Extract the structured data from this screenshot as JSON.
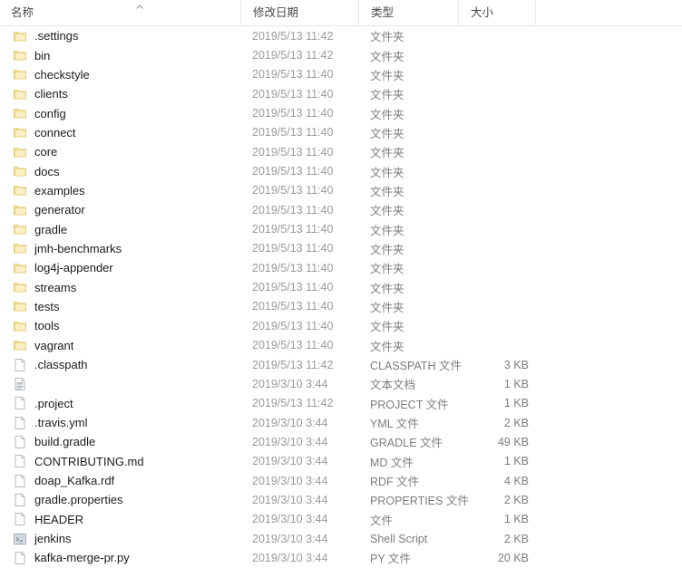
{
  "header": {
    "columns": [
      {
        "label": "名称",
        "key": "name"
      },
      {
        "label": "修改日期",
        "key": "date"
      },
      {
        "label": "类型",
        "key": "type"
      },
      {
        "label": "大小",
        "key": "size"
      }
    ],
    "sort_column": "名称",
    "sort_direction": "ascending",
    "sort_icon": "chevron-up-icon"
  },
  "colors": {
    "folder_fill": "#fbf0c4",
    "folder_edge": "#e8cf7e",
    "folder_tab": "#f5dd93",
    "file_fill": "#ffffff",
    "file_edge": "#b9b9b9",
    "text_primary": "#1b1b1b",
    "text_secondary": "#9a9a9a",
    "divider": "#eaeaea"
  },
  "rows": [
    {
      "name": ".settings",
      "icon": "folder-icon",
      "date": "2019/5/13 11:42",
      "type": "文件夹",
      "size": ""
    },
    {
      "name": "bin",
      "icon": "folder-icon",
      "date": "2019/5/13 11:42",
      "type": "文件夹",
      "size": ""
    },
    {
      "name": "checkstyle",
      "icon": "folder-icon",
      "date": "2019/5/13 11:40",
      "type": "文件夹",
      "size": ""
    },
    {
      "name": "clients",
      "icon": "folder-icon",
      "date": "2019/5/13 11:40",
      "type": "文件夹",
      "size": ""
    },
    {
      "name": "config",
      "icon": "folder-icon",
      "date": "2019/5/13 11:40",
      "type": "文件夹",
      "size": ""
    },
    {
      "name": "connect",
      "icon": "folder-icon",
      "date": "2019/5/13 11:40",
      "type": "文件夹",
      "size": ""
    },
    {
      "name": "core",
      "icon": "folder-icon",
      "date": "2019/5/13 11:40",
      "type": "文件夹",
      "size": ""
    },
    {
      "name": "docs",
      "icon": "folder-icon",
      "date": "2019/5/13 11:40",
      "type": "文件夹",
      "size": ""
    },
    {
      "name": "examples",
      "icon": "folder-icon",
      "date": "2019/5/13 11:40",
      "type": "文件夹",
      "size": ""
    },
    {
      "name": "generator",
      "icon": "folder-icon",
      "date": "2019/5/13 11:40",
      "type": "文件夹",
      "size": ""
    },
    {
      "name": "gradle",
      "icon": "folder-icon",
      "date": "2019/5/13 11:40",
      "type": "文件夹",
      "size": ""
    },
    {
      "name": "jmh-benchmarks",
      "icon": "folder-icon",
      "date": "2019/5/13 11:40",
      "type": "文件夹",
      "size": ""
    },
    {
      "name": "log4j-appender",
      "icon": "folder-icon",
      "date": "2019/5/13 11:40",
      "type": "文件夹",
      "size": ""
    },
    {
      "name": "streams",
      "icon": "folder-icon",
      "date": "2019/5/13 11:40",
      "type": "文件夹",
      "size": ""
    },
    {
      "name": "tests",
      "icon": "folder-icon",
      "date": "2019/5/13 11:40",
      "type": "文件夹",
      "size": ""
    },
    {
      "name": "tools",
      "icon": "folder-icon",
      "date": "2019/5/13 11:40",
      "type": "文件夹",
      "size": ""
    },
    {
      "name": "vagrant",
      "icon": "folder-icon",
      "date": "2019/5/13 11:40",
      "type": "文件夹",
      "size": ""
    },
    {
      "name": ".classpath",
      "icon": "file-icon",
      "date": "2019/5/13 11:42",
      "type": "CLASSPATH 文件",
      "size": "3 KB"
    },
    {
      "name": "",
      "icon": "text-document-icon",
      "date": "2019/3/10 3:44",
      "type": "文本文档",
      "size": "1 KB"
    },
    {
      "name": ".project",
      "icon": "file-icon",
      "date": "2019/5/13 11:42",
      "type": "PROJECT 文件",
      "size": "1 KB"
    },
    {
      "name": ".travis.yml",
      "icon": "file-icon",
      "date": "2019/3/10 3:44",
      "type": "YML 文件",
      "size": "2 KB"
    },
    {
      "name": "build.gradle",
      "icon": "file-icon",
      "date": "2019/3/10 3:44",
      "type": "GRADLE 文件",
      "size": "49 KB"
    },
    {
      "name": "CONTRIBUTING.md",
      "icon": "file-icon",
      "date": "2019/3/10 3:44",
      "type": "MD 文件",
      "size": "1 KB"
    },
    {
      "name": "doap_Kafka.rdf",
      "icon": "file-icon",
      "date": "2019/3/10 3:44",
      "type": "RDF 文件",
      "size": "4 KB"
    },
    {
      "name": "gradle.properties",
      "icon": "file-icon",
      "date": "2019/3/10 3:44",
      "type": "PROPERTIES 文件",
      "size": "2 KB"
    },
    {
      "name": "HEADER",
      "icon": "file-icon",
      "date": "2019/3/10 3:44",
      "type": "文件",
      "size": "1 KB"
    },
    {
      "name": "jenkins",
      "icon": "shell-script-icon",
      "date": "2019/3/10 3:44",
      "type": "Shell Script",
      "size": "2 KB"
    },
    {
      "name": "kafka-merge-pr.py",
      "icon": "file-icon",
      "date": "2019/3/10 3:44",
      "type": "PY 文件",
      "size": "20 KB"
    }
  ]
}
